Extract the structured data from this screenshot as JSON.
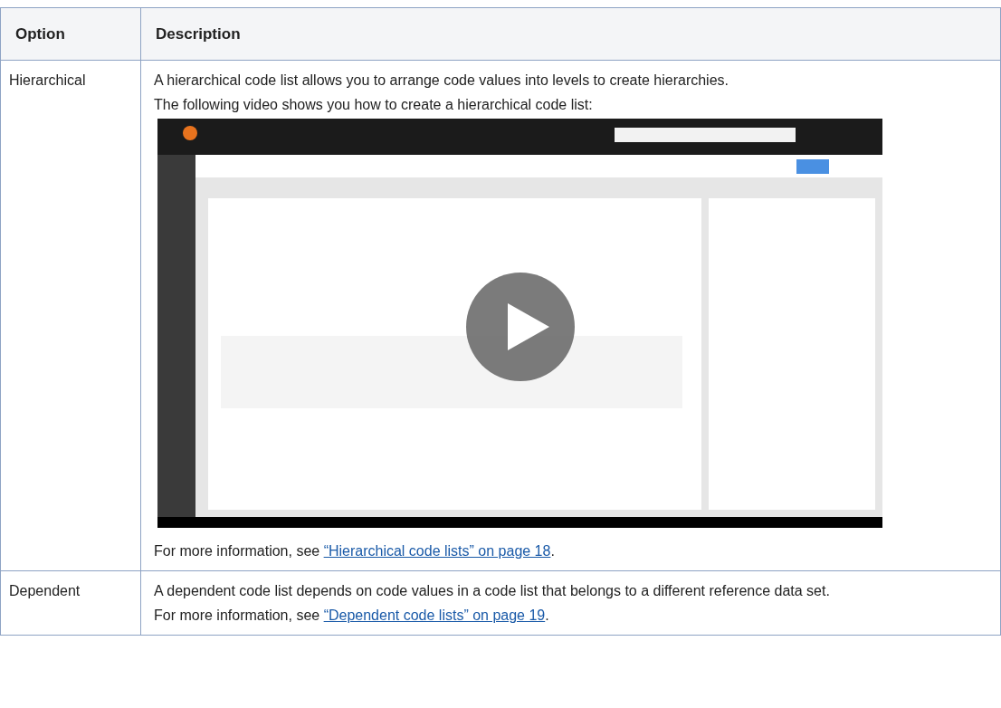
{
  "table": {
    "columns": [
      "Option",
      "Description"
    ],
    "rows": [
      {
        "option": "Hierarchical",
        "paragraphs": [
          "A hierarchical code list allows you to arrange code values into levels to create hierarchies.",
          "The following video shows you how to create a hierarchical code list:"
        ],
        "more": {
          "prefix": "For more information, see ",
          "link": "“Hierarchical code lists” on page 18",
          "suffix": "."
        }
      },
      {
        "option": "Dependent",
        "paragraphs": [
          "A dependent code list depends on code values in a code list that belongs to a different reference data set."
        ],
        "more": {
          "prefix": "For more information, see ",
          "link": "“Dependent code lists” on page 19",
          "suffix": "."
        }
      }
    ]
  }
}
